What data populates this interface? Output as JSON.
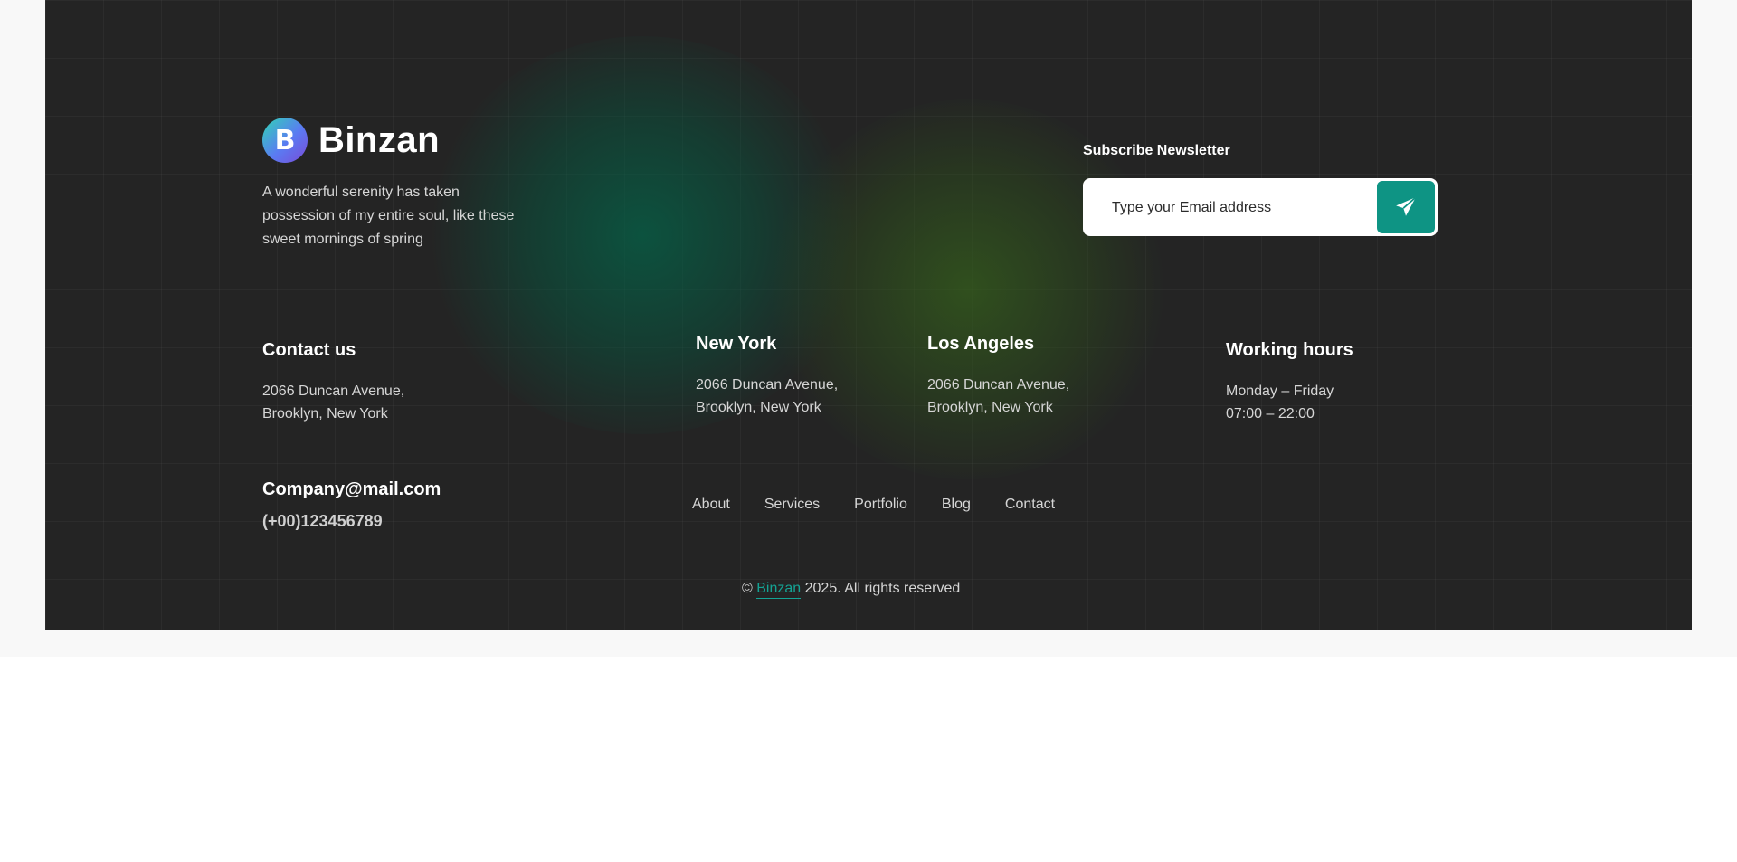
{
  "brand": {
    "name": "Binzan",
    "logo_letter": "B",
    "description": "A wonderful serenity has taken possession of my entire soul, like these sweet mornings of spring"
  },
  "newsletter": {
    "title": "Subscribe Newsletter",
    "placeholder": "Type your Email address",
    "submit_icon": "paper-plane-icon"
  },
  "contact": {
    "title": "Contact us",
    "line1": "2066 Duncan Avenue,",
    "line2": "Brooklyn, New York",
    "email": "Company@mail.com",
    "phone": "(+00)123456789"
  },
  "offices": [
    {
      "title": "New York",
      "line1": "2066 Duncan Avenue,",
      "line2": "Brooklyn, New York"
    },
    {
      "title": "Los Angeles",
      "line1": "2066 Duncan Avenue,",
      "line2": "Brooklyn, New York"
    }
  ],
  "hours": {
    "title": "Working hours",
    "line1": "Monday – Friday",
    "line2": "07:00 – 22:00"
  },
  "nav": {
    "items": [
      "About",
      "Services",
      "Portfolio",
      "Blog",
      "Contact"
    ]
  },
  "copyright": {
    "symbol": "©",
    "brand": "Binzan",
    "text": "2025. All rights reserved"
  },
  "colors": {
    "footer_bg": "#242424",
    "accent": "#0e9484",
    "link": "#14a394"
  }
}
